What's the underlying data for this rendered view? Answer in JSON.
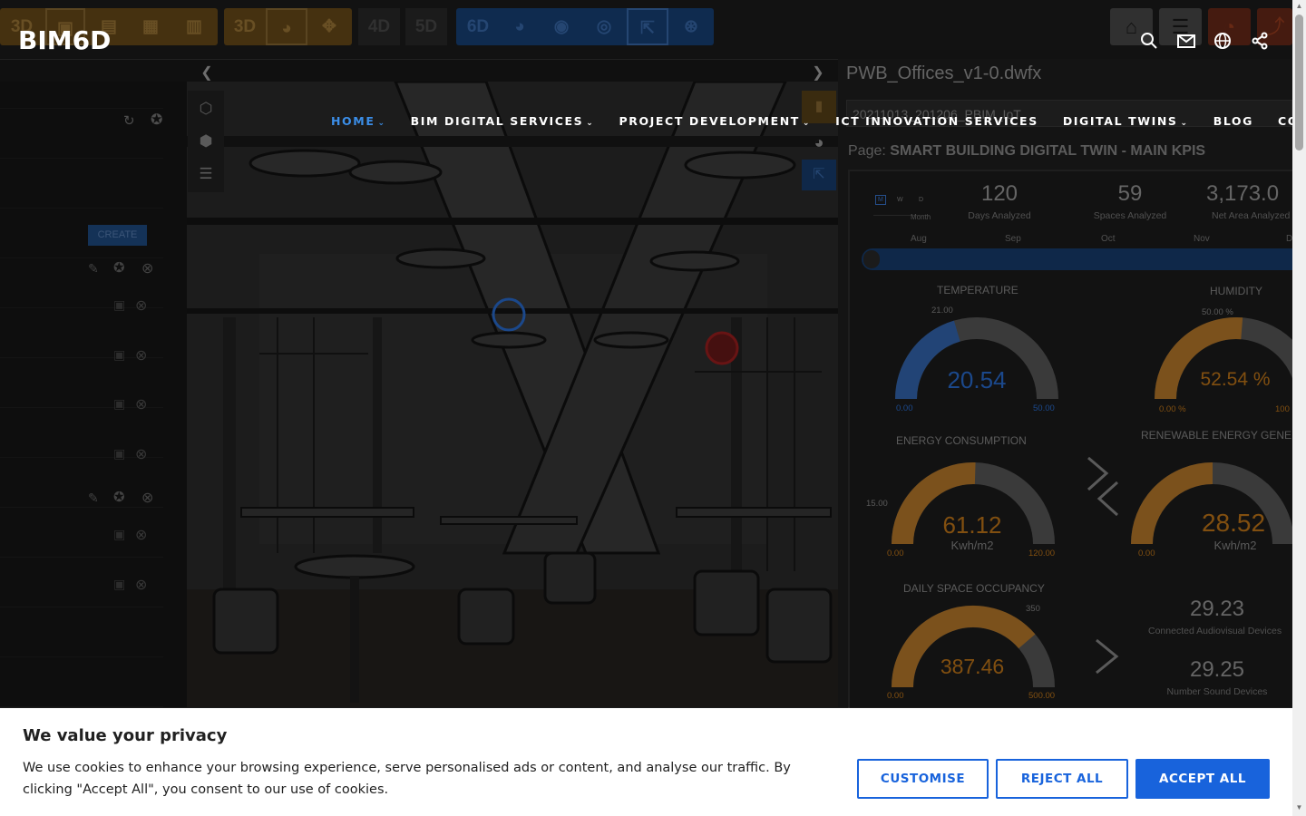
{
  "brand": {
    "logo_text": "BIM6D"
  },
  "nav": {
    "items": [
      {
        "label": "HOME",
        "active": true,
        "caret": true
      },
      {
        "label": "BIM DIGITAL SERVICES",
        "active": false,
        "caret": true
      },
      {
        "label": "PROJECT DEVELOPMENT",
        "active": false,
        "caret": true
      },
      {
        "label": "ICT INNOVATION SERVICES",
        "active": false,
        "caret": false
      },
      {
        "label": "DIGITAL TWINS",
        "active": false,
        "caret": true
      },
      {
        "label": "BLOG",
        "active": false,
        "caret": false
      },
      {
        "label": "CONTACT",
        "active": false,
        "caret": true
      }
    ],
    "caret_glyph": "⌄",
    "icons": [
      "search-icon",
      "mail-icon",
      "globe-icon",
      "share-icon"
    ]
  },
  "toolbar": {
    "group1_labels": [
      "3D"
    ],
    "group2_labels": [
      "3D"
    ],
    "group3_labels": [
      "4D",
      "5D"
    ],
    "group4_labels": [
      "6D"
    ],
    "colors": {
      "orange": "#f0a32a",
      "blue": "#2a78e0",
      "gray": "#3a3a3a"
    }
  },
  "left_panel": {
    "create_label": "CREATE"
  },
  "dashboard": {
    "file_name": "PWB_Offices_v1-0.dwfx",
    "file_sub": "20211013_201206_PBIM_IoT",
    "page_prefix": "Page:",
    "page_name": "SMART BUILDING DIGITAL TWIN - MAIN KPIS",
    "period_options": [
      "M",
      "W",
      "D"
    ],
    "period_sub": "Month",
    "kpis": [
      {
        "value": "120",
        "label": "Days Analyzed"
      },
      {
        "value": "59",
        "label": "Spaces Analyzed"
      },
      {
        "value": "3,173.0",
        "label": "Net Area Analyzed"
      }
    ],
    "months": [
      "Aug",
      "Sep",
      "Oct",
      "Nov",
      "D"
    ],
    "gauges": [
      {
        "title": "TEMPERATURE",
        "value": "20.54",
        "min": "0.00",
        "max": "50.00",
        "marker": "21.00",
        "fraction": 0.41,
        "color": "#2a6fd6"
      },
      {
        "title": "HUMIDITY",
        "value": "52.54 %",
        "min": "0.00 %",
        "max": "100",
        "marker": "50.00 %",
        "fraction": 0.5254,
        "color": "#e08a1e"
      },
      {
        "title": "ENERGY CONSUMPTION",
        "value": "61.12",
        "unit": "Kwh/m2",
        "min": "0.00",
        "max": "120.00",
        "marker": "15.00",
        "fraction": 0.509,
        "color": "#e08a1e"
      },
      {
        "title": "RENEWABLE ENERGY GENE",
        "value": "28.52",
        "unit": "Kwh/m2",
        "min": "0.00",
        "max": "",
        "marker": "",
        "fraction": 0.5,
        "color": "#e08a1e"
      },
      {
        "title": "DAILY SPACE OCCUPANCY",
        "value": "387.46",
        "min": "0.00",
        "max": "500.00",
        "marker": "350",
        "fraction": 0.775,
        "color": "#e08a1e"
      }
    ],
    "stats": [
      {
        "value": "29.23",
        "label": "Connected Audiovisual Devices"
      },
      {
        "value": "29.25",
        "label": "Number Sound Devices"
      }
    ]
  },
  "cookie": {
    "title": "We value your privacy",
    "text": "We use cookies to enhance your browsing experience, serve personalised ads or content, and analyse our traffic. By clicking \"Accept All\", you consent to our use of cookies.",
    "customise": "CUSTOMISE",
    "reject": "REJECT ALL",
    "accept": "ACCEPT ALL",
    "accent": "#1863dc"
  }
}
